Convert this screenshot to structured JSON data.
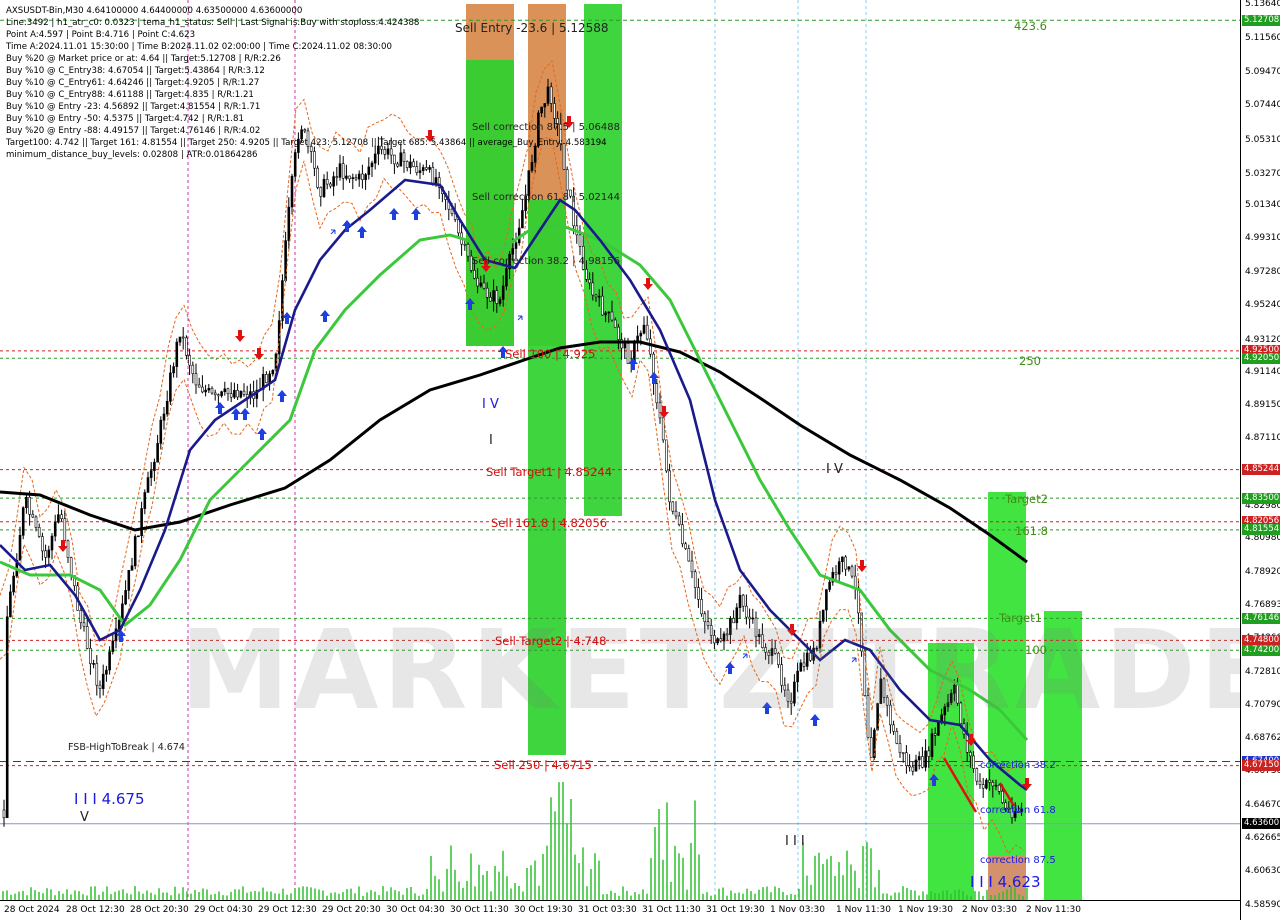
{
  "header": {
    "lines": [
      "AXSUSDT-Bin,M30  4.64100000 4.64400000 4.63500000 4.63600000",
      "Line:3492 | h1_atr_c0: 0.0323 | tema_h1_status: Sell | Last Signal is:Buy with stoploss:4.424388",
      "Point A:4.597 | Point B:4.716 | Point C:4.623",
      "Time A:2024.11.01 15:30:00 | Time B:2024.11.02 02:00:00 | Time C:2024.11.02 08:30:00",
      "Buy %20 @ Market price or at: 4.64 || Target:5.12708 | R/R:2.26",
      "Buy %10 @ C_Entry38: 4.67054 || Target:5.43864 | R/R:3.12",
      "Buy %10 @ C_Entry61: 4.64246 || Target:4.9205 | R/R:1.27",
      "Buy %10 @ C_Entry88: 4.61188 || Target:4.835 | R/R:1.21",
      "Buy %10 @ Entry -23: 4.56892 || Target:4.81554 | R/R:1.71",
      "Buy %10 @ Entry -50: 4.5375 || Target:4.742 | R/R:1.81",
      "Buy %20 @ Entry -88: 4.49157 || Target:4.76146 | R/R:4.02",
      "Target100: 4.742 || Target 161: 4.81554 || Target 250: 4.9205 || Target 423: 5.12708 || Target 685: 5.43864 || average_Buy_Entry: 4.583194",
      "minimum_distance_buy_levels: 0.02808 | ATR:0.01864286"
    ]
  },
  "price_axis": {
    "ticks": [
      "5.13640",
      "5.11560",
      "5.09470",
      "5.07440",
      "5.05310",
      "5.03270",
      "5.01340",
      "4.99310",
      "4.97280",
      "4.95240",
      "4.93120",
      "4.91140",
      "4.89150",
      "4.87110",
      "4.85010",
      "4.82980",
      "4.80980",
      "4.78920",
      "4.76893",
      "4.74860",
      "4.72810",
      "4.70790",
      "4.68762",
      "4.66730",
      "4.64670",
      "4.62665",
      "4.60630",
      "4.58590"
    ],
    "tags": [
      {
        "label": "5.12708",
        "color": "#1f9e1f"
      },
      {
        "label": "4.92500",
        "color": "#cc2222"
      },
      {
        "label": "4.92050",
        "color": "#1f9e1f"
      },
      {
        "label": "4.85244",
        "color": "#cc2222"
      },
      {
        "label": "4.83500",
        "color": "#1f9e1f"
      },
      {
        "label": "4.82056",
        "color": "#cc2222"
      },
      {
        "label": "4.81554",
        "color": "#1f9e1f"
      },
      {
        "label": "4.76146",
        "color": "#1f9e1f"
      },
      {
        "label": "4.74800",
        "color": "#cc2222"
      },
      {
        "label": "4.74200",
        "color": "#1f9e1f"
      },
      {
        "label": "4.67400",
        "color": "#2233cc"
      },
      {
        "label": "4.67150",
        "color": "#cc2222"
      },
      {
        "label": "4.63600",
        "color": "#000000"
      }
    ]
  },
  "time_axis": {
    "labels": [
      "28 Oct 2024",
      "28 Oct 12:30",
      "28 Oct 20:30",
      "29 Oct 04:30",
      "29 Oct 12:30",
      "29 Oct 20:30",
      "30 Oct 04:30",
      "30 Oct 11:30",
      "30 Oct 19:30",
      "31 Oct 03:30",
      "31 Oct 11:30",
      "31 Oct 19:30",
      "1 Nov 03:30",
      "1 Nov 11:30",
      "1 Nov 19:30",
      "2 Nov 03:30",
      "2 Nov 11:30"
    ]
  },
  "annotations": {
    "sell_entry": "Sell Entry -23.6 | 5.12588",
    "sell_corr_88": "Sell correction 87.5 | 5.06488",
    "sell_corr_61": "Sell correction 61.8 | 5.02144",
    "sell_corr_38": "Sell correction 38.2 | 4.98156",
    "sell_100": "Sell 100 | 4.925",
    "sell_target1": "Sell Target1 | 4.85244",
    "sell_161": "Sell 161.8 | 4.82056",
    "sell_target2": "Sell Target2 | 4.748",
    "sell_250": "Sell 250 | 4.6715",
    "fsb": "FSB-HighToBreak | 4.674",
    "iii_4675": "I I I 4.675",
    "iii_4623": "I I I 4.623",
    "lvl_4236": "423.6",
    "lvl_250": "250",
    "lvl_target2": "Target2",
    "lvl_1618": "161.8",
    "lvl_target1": "Target1",
    "lvl_100": "100",
    "corr_382": "correction 38.2",
    "corr_618": "correction 61.8",
    "corr_875": "correction 87.5",
    "wave_iv_1": "I V",
    "wave_iv_2": "I V",
    "wave_i": "I",
    "wave_iii": "I I I",
    "wave_v": "V",
    "top_text": "..."
  },
  "watermark": "MARKETZITRADE",
  "colors": {
    "sell_green": "#2ed12e",
    "sell_orange": "#d7894a",
    "buy_green": "#32e232",
    "tema": "#1a1a8c",
    "ma_green": "#3cc83c",
    "ma_black": "#000000",
    "red_dash": "#cc2222",
    "green_dash": "#2a9a2a",
    "blue_dash": "#2233cc"
  }
}
